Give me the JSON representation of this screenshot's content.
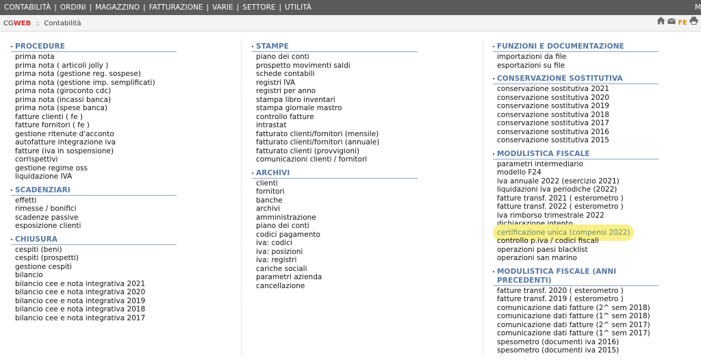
{
  "topbar": {
    "menus": [
      "CONTABILITÀ",
      "ORDINI",
      "MAGAZZINO",
      "FATTURAZIONE",
      "VARIE",
      "SETTORE",
      "UTILITÀ"
    ],
    "separator": "|",
    "edge_text": "M"
  },
  "subbar": {
    "brand_cg": "CG",
    "brand_web": "WEB",
    "separator": "::",
    "current": "Contabilità",
    "fe_label": "FE",
    "icons": [
      "home-icon",
      "mail-icon",
      "fe-icon",
      "print-icon"
    ]
  },
  "columns": [
    {
      "sections": [
        {
          "title": "PROCEDURE",
          "items": [
            "prima nota",
            "prima nota ( articoli jolly )",
            "prima nota (gestione reg. sospese)",
            "prima nota (gestione imp. semplificati)",
            "prima nota (giroconto cdc)",
            "prima nota (incassi banca)",
            "prima nota (spese banca)",
            "fatture clienti ( fe )",
            "fatture fornitori ( fe )",
            "gestione ritenute d'acconto",
            "autofatture integrazione iva",
            "fatture (iva in sospensione)",
            "corrispettivi",
            "gestione regime oss",
            "liquidazione IVA"
          ]
        },
        {
          "title": "SCADENZIARI",
          "items": [
            "effetti",
            "rimesse / bonifici",
            "scadenze passive",
            "esposizione clienti"
          ]
        },
        {
          "title": "CHIUSURA",
          "items": [
            "cespiti (beni)",
            "cespiti (prospetti)",
            "gestione cespiti",
            "bilancio",
            "bilancio cee e nota integrativa 2021",
            "bilancio cee e nota integrativa 2020",
            "bilancio cee e nota integrativa 2019",
            "bilancio cee e nota integrativa 2018",
            "bilancio cee e nota integrativa 2017"
          ]
        }
      ]
    },
    {
      "sections": [
        {
          "title": "STAMPE",
          "items": [
            "piano dei conti",
            "prospetto movimenti saldi",
            "schede contabili",
            "registri IVA",
            "registri per anno",
            "stampa libro inventari",
            "stampa giornale mastro",
            "controllo fatture",
            "intrastat",
            "fatturato clienti/fornitori (mensile)",
            "fatturato clienti/fornitori (annuale)",
            "fatturato clienti (provvigioni)",
            "comunicazioni clienti / fornitori"
          ]
        },
        {
          "title": "ARCHIVI",
          "items": [
            "clienti",
            "fornitori",
            "banche",
            "archivi",
            "amministrazione",
            "piano dei conti",
            "codici pagamento",
            "iva: codici",
            "iva: posizioni",
            "iva: registri",
            "cariche sociali",
            "parametri azienda",
            "cancellazione"
          ]
        }
      ]
    },
    {
      "sections": [
        {
          "title": "FUNZIONI E DOCUMENTAZIONE",
          "items": [
            "importazioni da file",
            "esportazioni su file"
          ]
        },
        {
          "title": "CONSERVAZIONE SOSTITUTIVA",
          "items": [
            "conservazione sostitutiva 2021",
            "conservazione sostitutiva 2020",
            "conservazione sostitutiva 2019",
            "conservazione sostitutiva 2018",
            "conservazione sostitutiva 2017",
            "conservazione sostitutiva 2016",
            "conservazione sostitutiva 2015"
          ]
        },
        {
          "title": "MODULISTICA FISCALE",
          "items": [
            "parametri intermediario",
            "modello F24",
            "iva annuale 2022 (esercizio 2021)",
            "liquidazioni iva periodiche (2022)",
            "fatture transf. 2021 ( esterometro )",
            "fatture transf. 2022 ( esterometro )",
            "iva rimborso trimestrale 2022",
            "dichiarazione intento",
            "certificazione unica (compensi 2022)",
            "controllo p.iva / codici fiscali",
            "operazioni paesi blacklist",
            "operazioni san marino"
          ]
        },
        {
          "title": "MODULISTICA FISCALE (ANNI PRECEDENTI)",
          "items": [
            "fatture transf. 2020 ( esterometro )",
            "fatture transf. 2019 ( esterometro )",
            "comunicazione dati fatture (2^ sem 2018)",
            "comunicazione dati fatture (1^ sem 2018)",
            "comunicazione dati fatture (2^ sem 2017)",
            "comunicazione dati fatture (1^ sem 2017)",
            "spesometro (documenti iva 2016)",
            "spesometro (documenti iva 2015)"
          ]
        }
      ]
    }
  ],
  "highlighted_item": "certificazione unica (compensi 2022)",
  "colors": {
    "topbar_bg": "#5b5b5b",
    "section_title": "#5577a3",
    "brand_web": "#d6262a",
    "highlight": "#f7f08a",
    "fe": "#d88b00"
  }
}
